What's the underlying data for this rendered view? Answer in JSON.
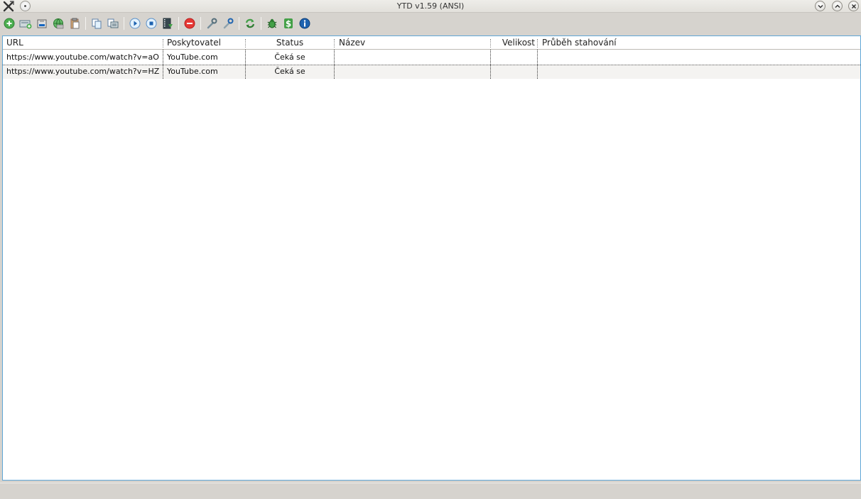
{
  "window": {
    "title": "YTD v1.59 (ANSI)"
  },
  "toolbar": {
    "buttons": [
      {
        "icon": "add-icon"
      },
      {
        "icon": "add-list-icon"
      },
      {
        "icon": "import-icon"
      },
      {
        "icon": "web-icon"
      },
      {
        "icon": "paste-icon"
      },
      {
        "icon": "copy-icon"
      },
      {
        "icon": "copy-list-icon"
      },
      {
        "icon": "play-icon"
      },
      {
        "icon": "stop-icon"
      },
      {
        "icon": "video-save-icon"
      },
      {
        "icon": "remove-icon"
      },
      {
        "icon": "settings-icon"
      },
      {
        "icon": "tools-icon"
      },
      {
        "icon": "refresh-icon"
      },
      {
        "icon": "bug-icon"
      },
      {
        "icon": "donate-icon"
      },
      {
        "icon": "info-icon"
      }
    ]
  },
  "table": {
    "columns": [
      "URL",
      "Poskytovatel",
      "Status",
      "Název",
      "Velikost",
      "Průběh stahování"
    ],
    "rows": [
      {
        "url": "https://www.youtube.com/watch?v=aO",
        "provider": "YouTube.com",
        "status": "Čeká se",
        "name": "",
        "size": "",
        "progress": ""
      },
      {
        "url": "https://www.youtube.com/watch?v=HZ",
        "provider": "YouTube.com",
        "status": "Čeká se",
        "name": "",
        "size": "",
        "progress": ""
      }
    ]
  },
  "colors": {
    "accent_border": "#5fa6d6",
    "window_bg": "#d6d3ce"
  }
}
